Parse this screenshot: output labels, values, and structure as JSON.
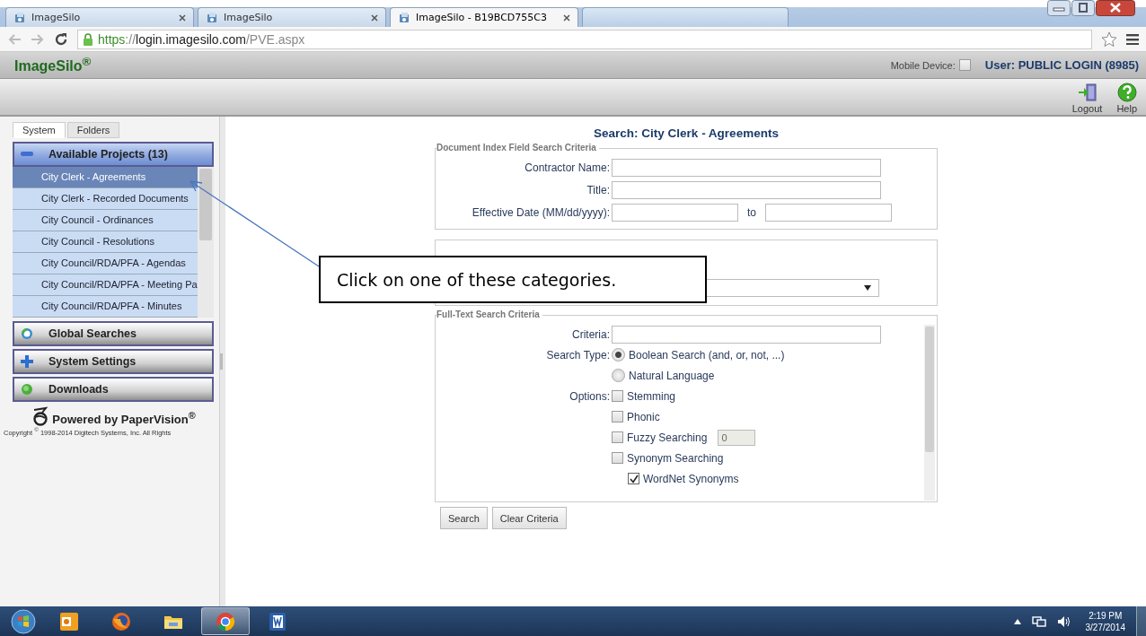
{
  "browser": {
    "tabs": [
      {
        "title": "ImageSilo",
        "selected": false
      },
      {
        "title": "ImageSilo",
        "selected": false
      },
      {
        "title": "ImageSilo - B19BCD755C3",
        "selected": true
      }
    ],
    "url": {
      "scheme": "https",
      "separator": "://",
      "host": "login.imagesilo.com",
      "path": "/PVE.aspx"
    }
  },
  "app_header": {
    "title": "ImageSilo$^{®}$",
    "mobile_device": {
      "label": "Mobile Device:",
      "checked": false
    },
    "user": "User: PUBLIC LOGIN (8985)"
  },
  "toolbar": [
    {
      "kind": "logout",
      "label": "Logout"
    },
    {
      "kind": "help",
      "label": "Help"
    }
  ],
  "sidebar": {
    "tabs": [
      {
        "label": "System",
        "selected": true
      },
      {
        "label": "Folders",
        "selected": false
      }
    ],
    "sections": [
      {
        "kind": "projects",
        "title": "Available Projects (13)",
        "expanded": true,
        "items": [
          {
            "label": "City Clerk - Agreements",
            "selected": true
          },
          {
            "label": "City Clerk - Recorded Documents",
            "selected": false
          },
          {
            "label": "City Council - Ordinances",
            "selected": false
          },
          {
            "label": "City Council - Resolutions",
            "selected": false
          },
          {
            "label": "City Council/RDA/PFA - Agendas",
            "selected": false
          },
          {
            "label": "City Council/RDA/PFA - Meeting Pa",
            "selected": false
          },
          {
            "label": "City Council/RDA/PFA - Minutes",
            "selected": false
          }
        ]
      },
      {
        "kind": "global",
        "title": "Global Searches",
        "expanded": false
      },
      {
        "kind": "settings",
        "title": "System Settings",
        "expanded": false
      },
      {
        "kind": "downloads",
        "title": "Downloads",
        "expanded": false
      }
    ],
    "powered_by": "Powered by PaperVision$^{®}$",
    "copyright": "Copyright $^{©}$ 1998-2014 Digitech Systems, Inc. All Rights"
  },
  "search": {
    "title": "Search: City Clerk - Agreements",
    "index_fields": {
      "legend": "Document Index Field Search Criteria",
      "rows": [
        {
          "label": "Contractor Name:"
        },
        {
          "label": "Title:"
        },
        {
          "label": "Effective Date (MM/dd/yyyy):",
          "range_separator": "to"
        }
      ]
    },
    "project_options": {
      "controls": [
        {
          "kind": "dropdown"
        }
      ]
    },
    "full_text": {
      "legend": "Full-Text Search Criteria",
      "criteria_label": "Criteria:",
      "search_type": {
        "label": "Search Type:",
        "options": [
          {
            "label": "Boolean Search (and, or, not, ...)",
            "selected": true
          },
          {
            "label": "Natural Language",
            "selected": false
          }
        ]
      },
      "options": {
        "label": "Options:",
        "items": [
          {
            "kind": "checkbox",
            "label": "Stemming",
            "checked": false
          },
          {
            "kind": "checkbox",
            "label": "Phonic",
            "checked": false
          },
          {
            "kind": "checkbox_number",
            "label": "Fuzzy Searching",
            "checked": false,
            "value": "0"
          },
          {
            "kind": "checkbox",
            "label": "Synonym Searching",
            "checked": false,
            "children": [
              {
                "kind": "checkbox",
                "label": "WordNet Synonyms",
                "checked": true
              }
            ]
          }
        ]
      }
    },
    "buttons": [
      "Search",
      "Clear Criteria"
    ]
  },
  "callout": {
    "text": "Click on one of these categories."
  },
  "taskbar": {
    "apps": [
      {
        "kind": "outlook",
        "active": false
      },
      {
        "kind": "firefox",
        "active": false
      },
      {
        "kind": "explorer",
        "active": false
      },
      {
        "kind": "chrome",
        "active": true
      },
      {
        "kind": "word",
        "active": false
      }
    ],
    "time": "2:19 PM",
    "date": "3/27/2014"
  }
}
